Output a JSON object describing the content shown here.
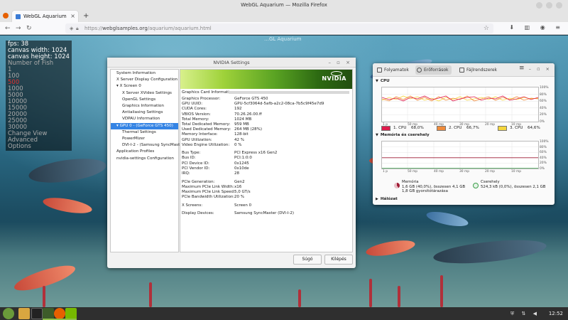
{
  "browser": {
    "window_title": "WebGL Aquarium — Mozilla Firefox",
    "tab_title": "WebGL Aquarium",
    "tab_close": "×",
    "new_tab": "+",
    "url_protocol": "https://",
    "url_host": "webglsamples.org",
    "url_path": "/aquarium/aquarium.html",
    "back": "←",
    "forward": "→",
    "reload": "↻",
    "right_icons": "⬇ ▥ ◉ ≡"
  },
  "aquarium": {
    "title": "…GL Aquarium",
    "hud": {
      "fps": "fps: 38",
      "canvas_width": "canvas width: 1024",
      "canvas_height": "canvas height: 1024",
      "number_of_fish_label": "Number of Fish",
      "fish_options": [
        "1",
        "100",
        "500",
        "1000",
        "5000",
        "10000",
        "15000",
        "20000",
        "25000",
        "30000"
      ],
      "selected_fish": "500",
      "menu": [
        "Change View",
        "Advanced",
        "Options"
      ]
    }
  },
  "nvidia": {
    "title": "NVIDIA Settings",
    "tree": [
      {
        "label": "System Information",
        "indent": 0,
        "selected": false
      },
      {
        "label": "X Server Display Configuration",
        "indent": 0,
        "selected": false
      },
      {
        "label": "▾ X Screen 0",
        "indent": 0,
        "selected": false
      },
      {
        "label": "X Server XVideo Settings",
        "indent": 1,
        "selected": false
      },
      {
        "label": "OpenGL Settings",
        "indent": 1,
        "selected": false
      },
      {
        "label": "Graphics Information",
        "indent": 1,
        "selected": false
      },
      {
        "label": "Antialiasing Settings",
        "indent": 1,
        "selected": false
      },
      {
        "label": "VDPAU Information",
        "indent": 1,
        "selected": false
      },
      {
        "label": "▾ GPU 0 - (GeForce GTS 450)",
        "indent": 0,
        "selected": true
      },
      {
        "label": "Thermal Settings",
        "indent": 1,
        "selected": false
      },
      {
        "label": "PowerMizer",
        "indent": 1,
        "selected": false
      },
      {
        "label": "DVI-I-2 - (Samsung SyncMaster)",
        "indent": 1,
        "selected": false
      },
      {
        "label": "Application Profiles",
        "indent": 0,
        "selected": false
      },
      {
        "label": "nvidia-settings Configuration",
        "indent": 0,
        "selected": false
      }
    ],
    "logo": "NVIDIA",
    "section_title": "Graphics Card Information",
    "groups": [
      [
        {
          "k": "Graphics Processor:",
          "v": "GeForce GTS 450"
        },
        {
          "k": "GPU UUID:",
          "v": "GPU-5cf3064d-5afb-a2c2-08ca-7b5c9f45e7d9"
        },
        {
          "k": "CUDA Cores:",
          "v": "192"
        },
        {
          "k": "VBIOS Version:",
          "v": "70.26.26.00.ff"
        },
        {
          "k": "Total Memory:",
          "v": "1024 MB"
        },
        {
          "k": "Total Dedicated Memory:",
          "v": "959 MB"
        },
        {
          "k": "Used Dedicated Memory:",
          "v": "264 MB (28%)"
        },
        {
          "k": "Memory Interface:",
          "v": "128-bit"
        },
        {
          "k": "GPU Utilization:",
          "v": "42 %"
        },
        {
          "k": "Video Engine Utilization:",
          "v": "0 %"
        }
      ],
      [
        {
          "k": "Bus Type:",
          "v": "PCI Express x16 Gen2"
        },
        {
          "k": "Bus ID:",
          "v": "PCI:1:0:0"
        },
        {
          "k": "PCI Device ID:",
          "v": "0x1245"
        },
        {
          "k": "PCI Vendor ID:",
          "v": "0x10de"
        },
        {
          "k": "IRQ:",
          "v": "28"
        }
      ],
      [
        {
          "k": "PCIe Generation:",
          "v": "Gen2"
        },
        {
          "k": "Maximum PCIe Link Width:",
          "v": "x16"
        },
        {
          "k": "Maximum PCIe Link Speed:",
          "v": "5,0 GT/s"
        },
        {
          "k": "PCIe Bandwidth Utilization:",
          "v": "20 %"
        }
      ],
      [
        {
          "k": "X Screens:",
          "v": "Screen 0"
        }
      ],
      [
        {
          "k": "Display Devices:",
          "v": "Samsung SyncMaster (DVI-I-2)"
        }
      ]
    ],
    "help_button": "Súgó",
    "quit_button": "Kilépés"
  },
  "sysmon": {
    "tabs": [
      "Folyamatok",
      "Erőforrások",
      "Fájlrendszerek"
    ],
    "active_tab": 1,
    "menu_icon": "≡",
    "window_controls": "– ▫ ×",
    "cpu_section": "CPU",
    "mem_section": "Memória és cserehely",
    "net_section": "Hálózat",
    "y_labels": [
      "100%",
      "80%",
      "60%",
      "40%",
      "20%",
      "0%"
    ],
    "x_labels": [
      "1 p",
      "50 mp",
      "40 mp",
      "30 mp",
      "20 mp",
      "10 mp"
    ],
    "cpus": [
      {
        "label": "1. CPU",
        "value": "68,0%",
        "color": "#e01b4c"
      },
      {
        "label": "2. CPU",
        "value": "66,7%",
        "color": "#f08c3c"
      },
      {
        "label": "3. CPU",
        "value": "64,6%",
        "color": "#f5d63c"
      }
    ],
    "memory": {
      "title": "Memória",
      "line1": "1,6 GB (40,0%), összesen 4,1 GB",
      "line2": "1,8 GB gyorsítótárazása",
      "color": "#9e1b34"
    },
    "swap": {
      "title": "Cserehely",
      "line1": "524,3 kB (0,0%), összesen 2,1 GB",
      "color": "#3c9e4a"
    }
  },
  "taskbar": {
    "time": "12:52",
    "tray": "⛨ ⇅ ◀"
  }
}
